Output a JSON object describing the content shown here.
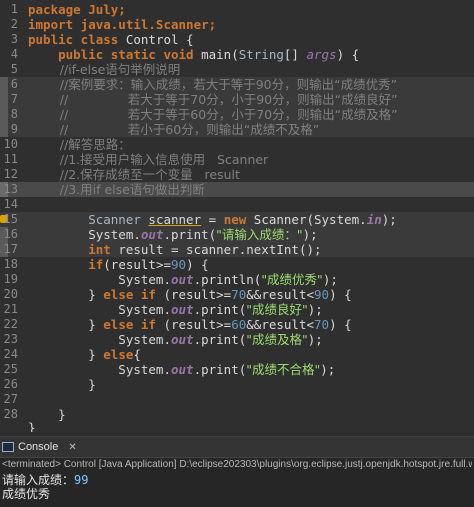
{
  "editor": {
    "line_numbers": [
      "1",
      "2",
      "3",
      "4",
      "5",
      "6",
      "7",
      "8",
      "9",
      "10",
      "11",
      "12",
      "13",
      "14",
      "15",
      "16",
      "17",
      "18",
      "19",
      "20",
      "21",
      "22",
      "23",
      "24",
      "25",
      "26",
      "27",
      "28"
    ],
    "lines": {
      "l1": "package July;",
      "l2": "import java.util.Scanner;",
      "l3a": "public class",
      "l3b": " Control {",
      "l4a": "    public static void",
      "l4b": " main(",
      "l4c": "String",
      "l4d": "[] ",
      "l4e": "args",
      "l4f": ") {",
      "l5": "        //if-else语句举例说明",
      "l6": "        //案例要求：输入成绩，若大于等于90分，则输出“成绩优秀”",
      "l7": "        //               若大于等于70分，小于90分，则输出“成绩良好”",
      "l8": "        //               若大于等于60分，小于70分，则输出“成绩及格”",
      "l9": "        //               若小于60分，则输出“成绩不及格”",
      "l10": "        //解答思路：",
      "l11": "        //1.接受用户输入信息使用   Scanner",
      "l12": "        //2.保存成绩至一个变量   result",
      "l13": "        //3.用if else语句做出判断",
      "l15a": "        Scanner ",
      "l15b": "scanner",
      "l15c": " = ",
      "l15d": "new",
      "l15e": " Scanner(System.",
      "l15f": "in",
      "l15g": ");",
      "l16a": "        System.",
      "l16b": "out",
      "l16c": ".print(",
      "l16d": "\"请输入成绩：\"",
      "l16e": ");",
      "l17a": "        int",
      "l17b": " result = scanner.nextInt();",
      "l18a": "        if",
      "l18b": "(result>=",
      "l18c": "90",
      "l18d": ") {",
      "l19a": "            System.",
      "l19b": "out",
      "l19c": ".println(",
      "l19d": "\"成绩优秀\"",
      "l19e": ");",
      "l20a": "        } ",
      "l20b": "else if",
      "l20c": " (result>=",
      "l20d": "70",
      "l20e": "&&result<",
      "l20f": "90",
      "l20g": ") {",
      "l21a": "            System.",
      "l21b": "out",
      "l21c": ".print(",
      "l21d": "\"成绩良好\"",
      "l21e": ");",
      "l22a": "        } ",
      "l22b": "else if",
      "l22c": " (result>=",
      "l22d": "60",
      "l22e": "&&result<",
      "l22f": "70",
      "l22g": ") {",
      "l23a": "            System.",
      "l23b": "out",
      "l23c": ".print(",
      "l23d": "\"成绩及格\"",
      "l23e": ");",
      "l24a": "        } ",
      "l24b": "else",
      "l24c": "{",
      "l25a": "            System.",
      "l25b": "out",
      "l25c": ".print(",
      "l25d": "\"成绩不合格\"",
      "l25e": ");",
      "l26": "        }",
      "l28": "    }",
      "l29": "}"
    }
  },
  "console": {
    "tab_label": "Console",
    "close_glyph": "✕",
    "terminated_line": "<terminated> Control [Java Application] D:\\eclipse202303\\plugins\\org.eclipse.justj.openjdk.hotspot.jre.full.win32.x86_6",
    "prompt_text": "请输入成绩：",
    "prompt_value": "99",
    "output_text": "成绩优秀"
  }
}
